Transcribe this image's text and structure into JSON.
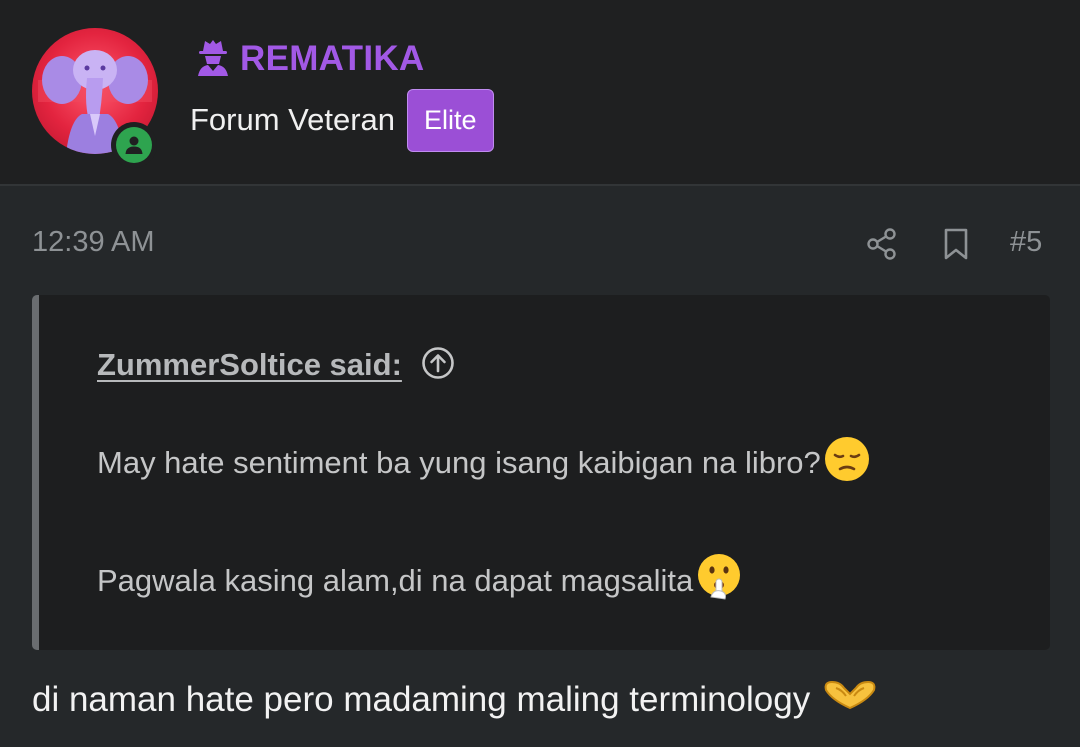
{
  "user": {
    "username": "REMATIKA",
    "title": "Forum Veteran",
    "badge": "Elite",
    "status": "online",
    "username_color": "#a259e6",
    "badge_color": "#9b4fd6",
    "online_color": "#2ea44f",
    "icons": {
      "role": "detective-icon",
      "status": "user-online-icon"
    }
  },
  "post": {
    "time": "12:39 AM",
    "number": "#5",
    "actions": {
      "share_icon": "share-icon",
      "bookmark_icon": "bookmark-icon"
    },
    "quote": {
      "author": "ZummerSoltice said:",
      "jump_icon": "arrow-up-circle-icon",
      "line1": "May hate sentiment ba yung isang kaibigan na libro?",
      "line1_emoji": "pensive-face-emoji",
      "line2": "Pagwala kasing alam,di na dapat magsalita",
      "line2_emoji": "shushing-face-emoji"
    },
    "body": "di naman hate pero madaming maling terminology",
    "body_emoji": "heart-hands-emoji"
  },
  "colors": {
    "background": "#25282a",
    "header_background": "#1f2021",
    "quote_background": "#1d1e1f",
    "quote_border": "#6a6d70",
    "muted_text": "#8e9295"
  }
}
